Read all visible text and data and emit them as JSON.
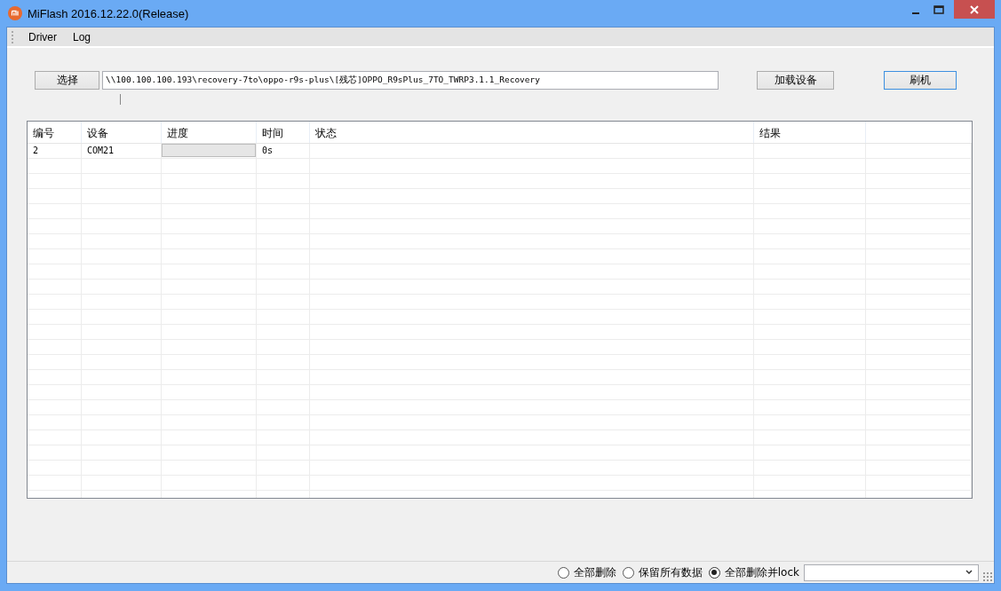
{
  "window": {
    "title": "MiFlash 2016.12.22.0(Release)"
  },
  "menu": [
    "Driver",
    "Log"
  ],
  "toolbar": {
    "select_button": "选择",
    "path": "\\\\100.100.100.193\\recovery-7to\\oppo-r9s-plus\\[残芯]OPPO_R9sPlus_7TO_TWRP3.1.1_Recovery",
    "load_button": "加载设备",
    "flash_button": "刷机"
  },
  "table": {
    "columns": [
      "编号",
      "设备",
      "进度",
      "时间",
      "状态",
      "结果"
    ],
    "rows": [
      {
        "id": "2",
        "device": "COM21",
        "level": 0,
        "time": "0s",
        "status": "",
        "result": ""
      }
    ]
  },
  "status_bar": {
    "options": [
      {
        "label": "全部删除",
        "selected": false
      },
      {
        "label": "保留所有数据",
        "selected": false
      },
      {
        "label": "全部删除并lock",
        "selected": true
      }
    ]
  }
}
